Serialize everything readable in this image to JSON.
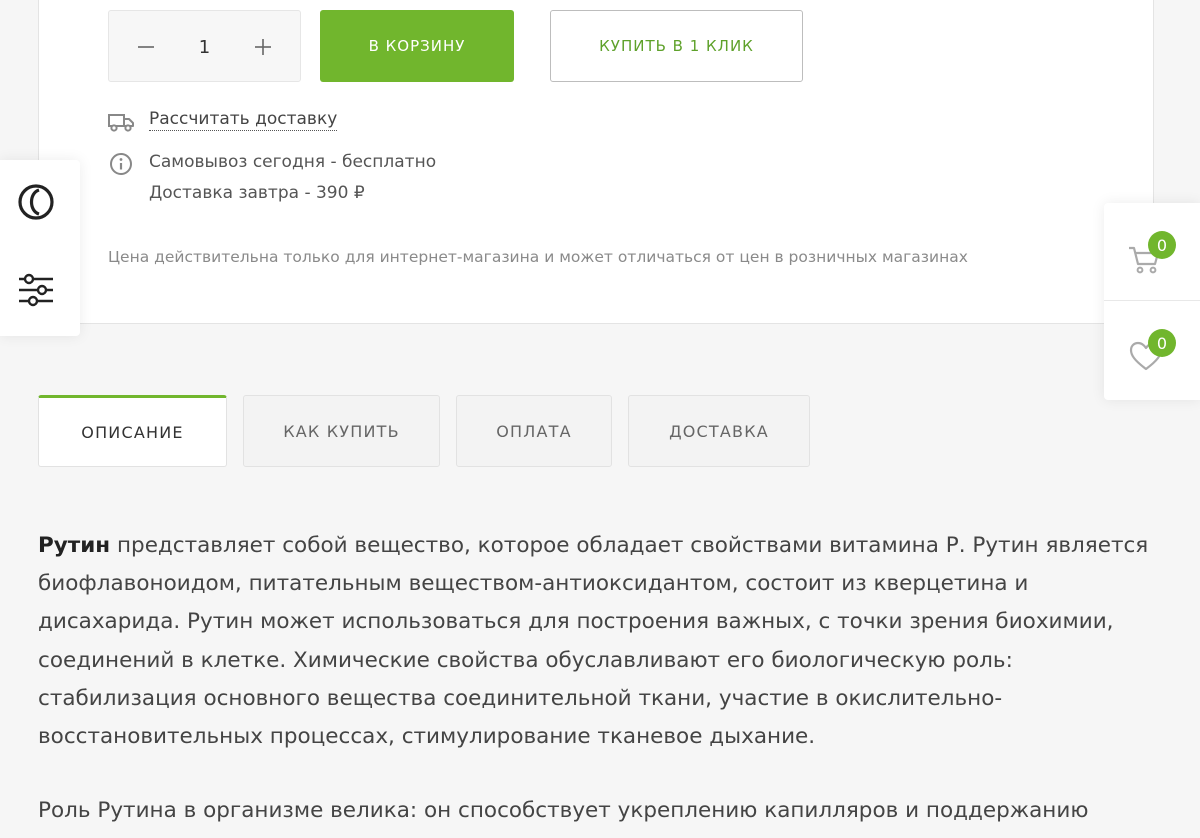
{
  "product": {
    "quantity": "1",
    "add_to_cart_label": "В КОРЗИНУ",
    "buy_one_click_label": "КУПИТЬ В 1 КЛИК",
    "calc_delivery_label": "Рассчитать доставку",
    "pickup_text": "Самовывоз сегодня - бесплатно",
    "delivery_text": "Доставка завтра - 390 ₽",
    "price_note": "Цена действительна только для интернет-магазина и может отличаться от цен в розничных магазинах"
  },
  "side_right": {
    "cart_count": "0",
    "favorites_count": "0"
  },
  "tabs": [
    {
      "label": "ОПИСАНИЕ",
      "active": true
    },
    {
      "label": "КАК КУПИТЬ",
      "active": false
    },
    {
      "label": "ОПЛАТА",
      "active": false
    },
    {
      "label": "ДОСТАВКА",
      "active": false
    }
  ],
  "description": {
    "bold_term": "Рутин",
    "paragraph1": " представляет собой вещество, которое обладает свойствами витамина Р. Рутин является биофлавоноидом, питательным веществом-антиоксидантом, состоит из кверцетина и дисахарида. Рутин может использоваться для построения важных, с точки зрения биохимии, соединений в клетке. Химические свойства обуславливают его биологическую роль: стабилизация основного вещества соединительной ткани, участие в окислительно-восстановительных процессах, стимулирование тканевое дыхание.",
    "paragraph2": "Роль Рутина в организме велика: он способствует укреплению капилляров и поддержанию"
  },
  "colors": {
    "accent": "#71b62d",
    "accent_text": "#5ea12a",
    "background": "#f6f6f6"
  }
}
